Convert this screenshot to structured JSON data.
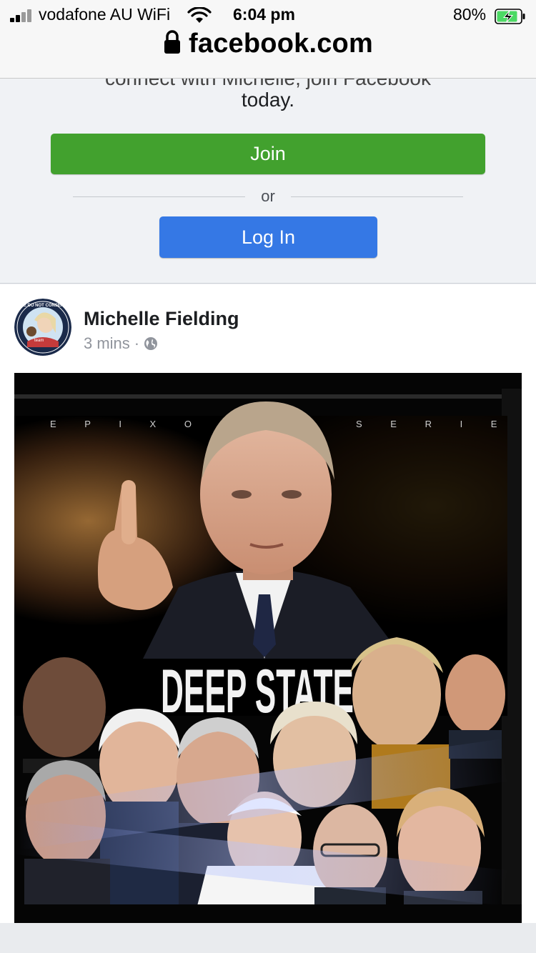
{
  "status_bar": {
    "carrier": "vodafone AU WiFi",
    "time": "6:04 pm",
    "battery_percent": "80%"
  },
  "url_bar": {
    "domain": "facebook.com"
  },
  "join_prompt": {
    "cut_text": "connect with Michelle, join Facebook",
    "today_text": "today.",
    "join_label": "Join",
    "or_label": "or",
    "login_label": "Log In",
    "join_color": "#42a12e",
    "login_color": "#3578e5"
  },
  "post": {
    "author_name": "Michelle Fielding",
    "timestamp": "3 mins",
    "separator": "·",
    "privacy_icon": "globe-icon",
    "avatar_ring_text": "WE DO NOT CONSENT",
    "image": {
      "series_text_left": "E P I X   O R I",
      "series_text_right": "S E R I E S",
      "headline": "DEEP STATE"
    }
  }
}
